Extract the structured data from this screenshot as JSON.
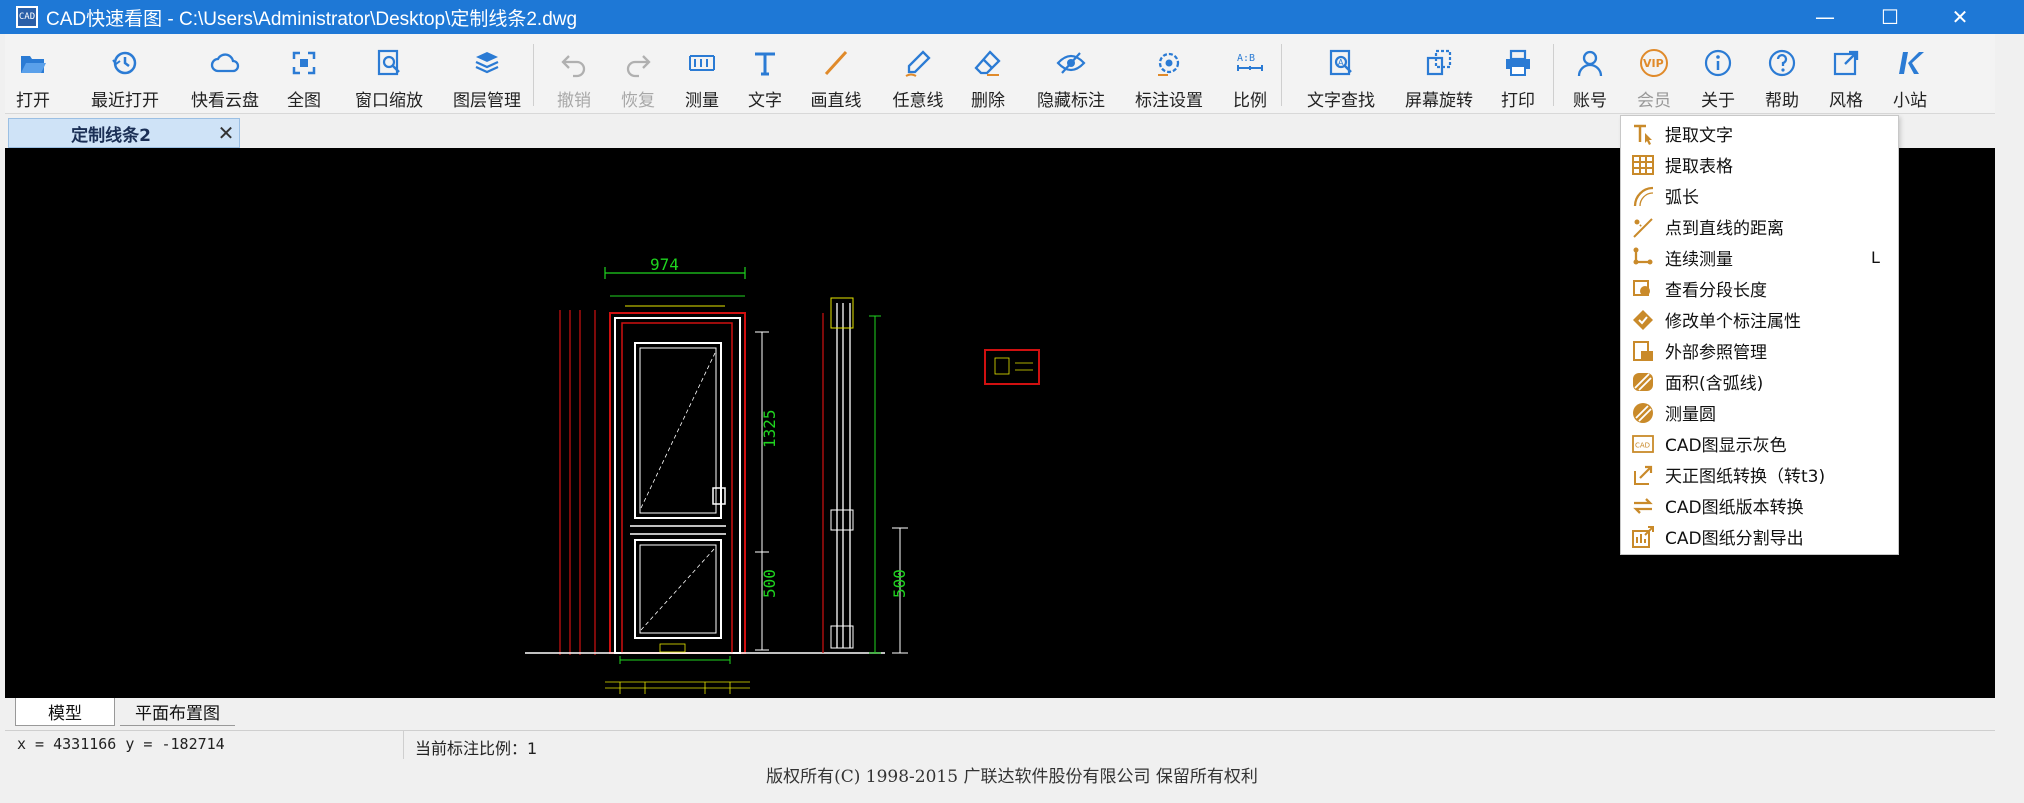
{
  "window": {
    "title": "CAD快速看图 - C:\\Users\\Administrator\\Desktop\\定制线条2.dwg",
    "logo_text": "CAD",
    "minimize": "—",
    "maximize": "☐",
    "close": "✕"
  },
  "toolbar": {
    "open": "打开",
    "recent": "最近打开",
    "cloud": "快看云盘",
    "full_view": "全图",
    "window_zoom": "窗口缩放",
    "layers": "图层管理",
    "undo": "撤销",
    "redo": "恢复",
    "measure": "测量",
    "text": "文字",
    "line": "画直线",
    "freehand": "任意线",
    "delete": "删除",
    "hide_annot": "隐藏标注",
    "annot_settings": "标注设置",
    "scale": "比例",
    "find_text": "文字查找",
    "rotate": "屏幕旋转",
    "print": "打印",
    "account": "账号",
    "vip": "会员",
    "about": "关于",
    "help": "帮助",
    "style": "风格",
    "site": "小站"
  },
  "tabs": {
    "doc_tab": "定制线条2",
    "doc_close": "✕",
    "model": "模型",
    "layout": "平面布置图"
  },
  "drawing": {
    "dim_top": "974",
    "dim_1325": "1325",
    "dim_500_left": "500",
    "dim_500_right": "500"
  },
  "status": {
    "coords": "x = 4331166 y = -182714",
    "scale": "当前标注比例：1"
  },
  "copyright": "版权所有(C) 1998-2015 广联达软件股份有限公司 保留所有权利",
  "vip_menu": {
    "items": [
      {
        "label": "提取文字",
        "icon": "extract-text-icon"
      },
      {
        "label": "提取表格",
        "icon": "extract-table-icon"
      },
      {
        "label": "弧长",
        "icon": "arc-length-icon"
      },
      {
        "label": "点到直线的距离",
        "icon": "point-line-distance-icon"
      },
      {
        "label": "连续测量",
        "icon": "continuous-measure-icon",
        "shortcut": "L"
      },
      {
        "label": "查看分段长度",
        "icon": "segment-length-icon"
      },
      {
        "label": "修改单个标注属性",
        "icon": "edit-annotation-icon"
      },
      {
        "label": "外部参照管理",
        "icon": "xref-icon"
      },
      {
        "label": "面积(含弧线)",
        "icon": "area-icon"
      },
      {
        "label": "测量圆",
        "icon": "measure-circle-icon"
      },
      {
        "label": "CAD图显示灰色",
        "icon": "cad-gray-icon"
      },
      {
        "label": "天正图纸转换（转t3)",
        "icon": "tangent-convert-icon"
      },
      {
        "label": "CAD图纸版本转换",
        "icon": "version-convert-icon"
      },
      {
        "label": "CAD图纸分割导出",
        "icon": "split-export-icon"
      }
    ]
  },
  "colors": {
    "title_bar": "#1e78d6",
    "icon_blue": "#2b7bd4",
    "icon_orange": "#e08a2a",
    "menu_icon": "#c98a2a",
    "cad_green": "#1fd41f",
    "cad_red": "#d01010",
    "cad_white": "#ffffff"
  }
}
